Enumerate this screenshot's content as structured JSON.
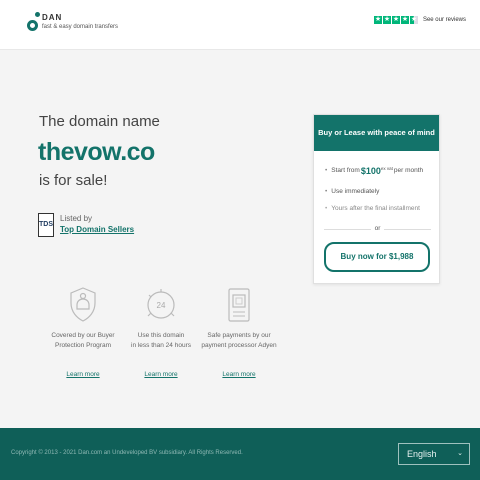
{
  "header": {
    "logo_name": "DAN",
    "logo_tagline": "fast & easy domain transfers",
    "reviews_label": "See our reviews",
    "star_icon": "★",
    "trust_stars": 4.5,
    "star_color": "#00b67a"
  },
  "hero": {
    "line1": "The domain name",
    "domain": "thevow.co",
    "line3": "is for sale!"
  },
  "seller": {
    "badge": "TDS",
    "listed": "Listed by",
    "name": "Top Domain Sellers"
  },
  "features": [
    {
      "icon": "shield-hand-icon",
      "text1": "Covered by our Buyer",
      "text2": "Protection Program",
      "link": "Learn more"
    },
    {
      "icon": "clock-24-icon",
      "text1": "Use this domain",
      "text2": "in less than 24 hours",
      "link": "Learn more"
    },
    {
      "icon": "payment-terminal-icon",
      "text1": "Safe payments by our",
      "text2": "payment processor Adyen",
      "link": "Learn more"
    }
  ],
  "panel": {
    "title": "Buy or Lease with peace of mind",
    "item1_prefix": "Start from",
    "item1_price": "$100",
    "item1_vat": "ex vat",
    "item1_suffix": "per month",
    "item2": "Use immediately",
    "item3": "Yours after the final installment",
    "or": "or",
    "buy_label": "Buy now for $1,988",
    "bullet": "•"
  },
  "footer": {
    "copyright": "Copyright © 2013 - 2021 Dan.com an Undeveloped BV subsidiary. All Rights Reserved.",
    "language": "English",
    "caret": "⌄"
  },
  "colors": {
    "brand": "#13736a",
    "footer": "#0f5f58"
  }
}
